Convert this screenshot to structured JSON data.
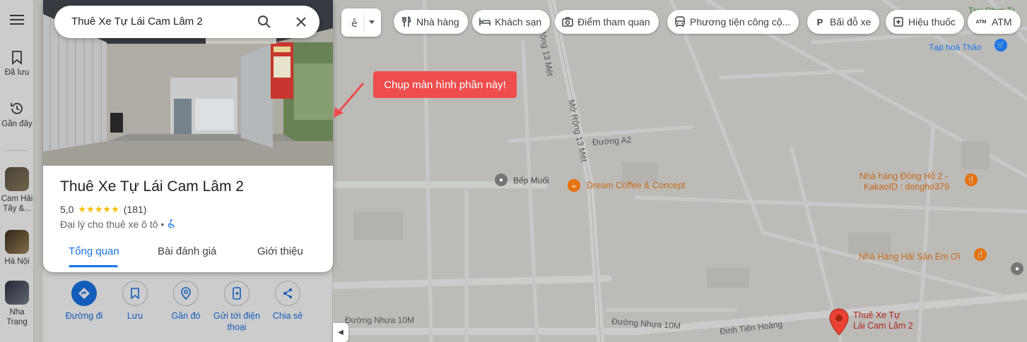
{
  "search": {
    "value": "Thuê Xe Tự Lái Cam Lâm 2"
  },
  "rail": {
    "menu_icon": "menu-icon",
    "items": [
      {
        "label": "Đã lưu",
        "icon": "bookmark-icon"
      },
      {
        "label": "Gần đây",
        "icon": "history-icon"
      }
    ],
    "recents": [
      {
        "label_1": "Cam Hải",
        "label_2": "Tây &..."
      },
      {
        "label_1": "Hà Nội",
        "label_2": ""
      },
      {
        "label_1": "Nha",
        "label_2": "Trang"
      }
    ]
  },
  "place": {
    "title": "Thuê Xe Tự Lái Cam Lâm 2",
    "rating": "5,0",
    "stars": "★★★★★",
    "reviews": "(181)",
    "category": "Đại lý cho thuê xe ô tô",
    "separator": "•",
    "accessibility_icon": "wheelchair-icon"
  },
  "tabs": [
    {
      "label": "Tổng quan",
      "active": true
    },
    {
      "label": "Bài đánh giá",
      "active": false
    },
    {
      "label": "Giới thiệu",
      "active": false
    }
  ],
  "actions": [
    {
      "label_1": "Đường đi",
      "label_2": "",
      "icon": "directions-icon"
    },
    {
      "label_1": "Lưu",
      "label_2": "",
      "icon": "bookmark-icon"
    },
    {
      "label_1": "Gần đó",
      "label_2": "",
      "icon": "nearby-icon"
    },
    {
      "label_1": "Gửi tới điện",
      "label_2": "thoại",
      "icon": "send-to-phone-icon"
    },
    {
      "label_1": "Chia sẻ",
      "label_2": "",
      "icon": "share-icon"
    }
  ],
  "chips": [
    {
      "label": "Nhà hàng",
      "icon": "restaurant-icon"
    },
    {
      "label": "Khách sạn",
      "icon": "hotel-icon"
    },
    {
      "label": "Điểm tham quan",
      "icon": "camera-icon"
    },
    {
      "label": "Phương tiện công cộ...",
      "icon": "transit-icon"
    },
    {
      "label": "Bãi đỗ xe",
      "icon": "parking-icon"
    },
    {
      "label": "Hiệu thuốc",
      "icon": "pharmacy-icon"
    },
    {
      "label": "ATM",
      "icon": "atm-icon"
    }
  ],
  "callout": {
    "text": "Chụp màn hình phần này!"
  },
  "map": {
    "labels": {
      "road_mo_rong_top": "Mở Rộng 13 Mét",
      "road_mo_rong": "Mở Rộng 13 Mét",
      "road_a2": "Đường A2",
      "road_nhua_1": "Đường Nhựa 10M",
      "road_nhua_2": "Đường Nhựa 10M",
      "road_dinh_tien_hoang": "Đinh Tiên Hoàng",
      "bep_muoi": "Bếp Muối",
      "dream_coffee": "Dream Coffee & Concept",
      "dong_ho_1": "Nhà hàng Đông Hồ 2 -",
      "dong_ho_2": "KakaoID : dongho379",
      "hai_san": "Nhà Hàng Hải Sản Em Ơi",
      "tap_hoa": "Tạp hoá Thảo",
      "trai_chim": "Trại Chim Tr",
      "marker_1": "Thuê Xe Tự",
      "marker_2": "Lái Cam Lâm 2"
    }
  }
}
